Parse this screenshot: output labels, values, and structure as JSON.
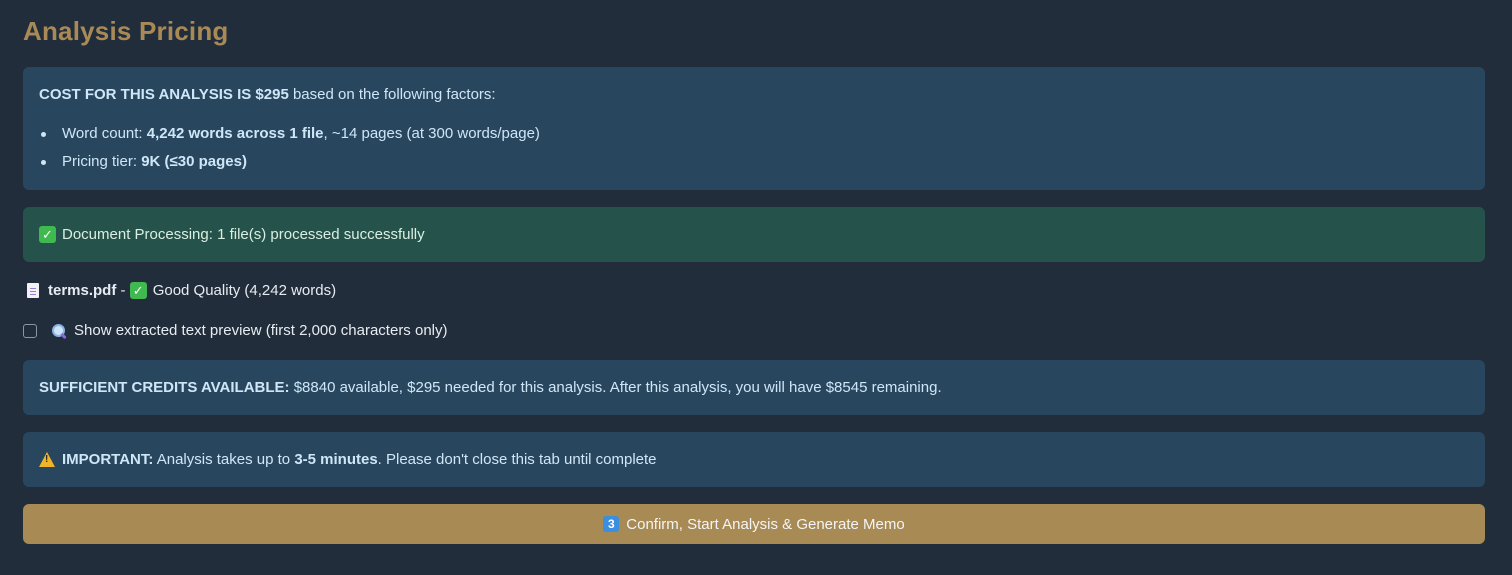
{
  "page": {
    "title": "Analysis Pricing"
  },
  "cost": {
    "heading": "COST FOR THIS ANALYSIS IS $295",
    "heading_suffix": " based on the following factors:",
    "word_count_label": "Word count: ",
    "word_count_value": "4,242 words across 1 file",
    "word_count_suffix": ", ~14 pages (at 300 words/page)",
    "tier_label": "Pricing tier: ",
    "tier_value": "9K (≤30 pages)"
  },
  "processing": {
    "icon": "check-mark-icon",
    "text": "Document Processing: 1 file(s) processed successfully"
  },
  "file": {
    "icon": "document-icon",
    "name": "terms.pdf",
    "separator": " - ",
    "quality_icon": "check-mark-icon",
    "quality_text": "Good Quality (4,242 words)"
  },
  "preview": {
    "checked": false,
    "icon": "magnifier-icon",
    "label": "Show extracted text preview (first 2,000 characters only)"
  },
  "credits": {
    "heading": "SUFFICIENT CREDITS AVAILABLE:",
    "text": " $8840 available, $295 needed for this analysis. After this analysis, you will have $8545 remaining."
  },
  "important": {
    "icon": "warning-icon",
    "heading": "IMPORTANT:",
    "text_before": " Analysis takes up to ",
    "duration": "3-5 minutes",
    "text_after": ". Please don't close this tab until complete"
  },
  "confirm": {
    "number": "3",
    "label": "Confirm, Start Analysis & Generate Memo"
  },
  "colors": {
    "background": "#212d3a",
    "accent": "#a88a55",
    "info_box": "#28475f",
    "success_box": "#25524a"
  }
}
